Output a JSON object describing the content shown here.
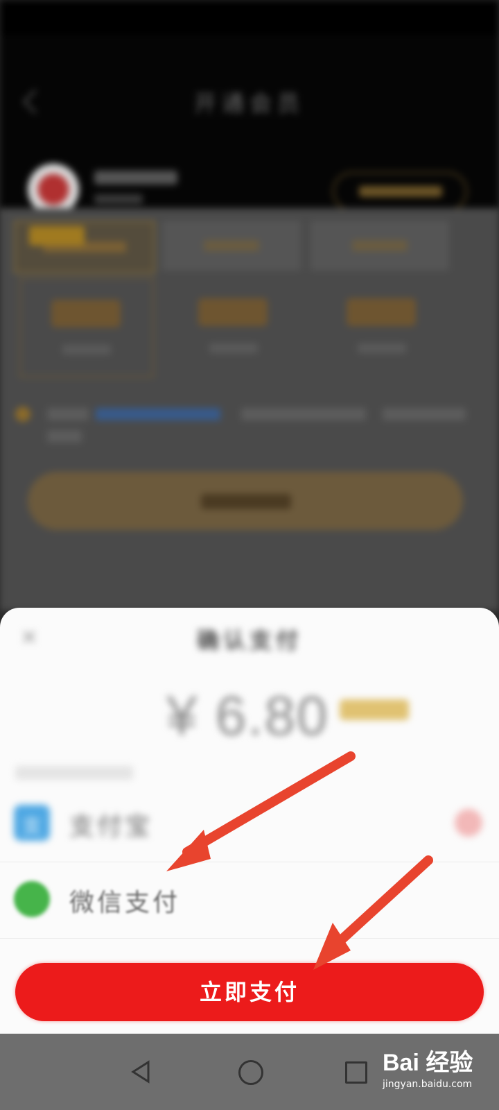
{
  "status_bar": {},
  "background_page": {
    "title": "开通会员"
  },
  "payment_sheet": {
    "close_icon": "close-icon",
    "title": "确认支付",
    "amount": "¥ 6.80",
    "methods": [
      {
        "name": "支付宝",
        "icon": "alipay-icon"
      },
      {
        "name": "微信支付",
        "icon": "wechat-pay-icon"
      }
    ],
    "pay_button": "立即支付"
  },
  "nav_bar": {
    "back_icon": "nav-back-icon",
    "home_icon": "nav-home-icon",
    "recent_icon": "nav-recent-icon"
  },
  "watermark": {
    "brand": "Bai 经验",
    "url": "jingyan.baidu.com"
  },
  "colors": {
    "pay_button": "#ec1b1b",
    "arrow": "#e8442e",
    "wechat": "#46b44a",
    "alipay": "#4fa8e3"
  }
}
